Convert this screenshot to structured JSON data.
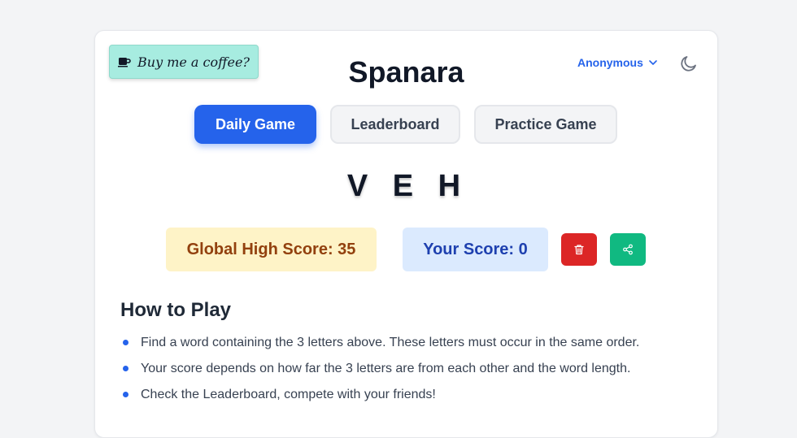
{
  "coffee": {
    "label": "Buy me a coffee?",
    "icon": "coffee-cup-icon"
  },
  "app": {
    "title": "Spanara"
  },
  "user": {
    "name": "Anonymous",
    "icon": "chevron-down-icon"
  },
  "theme_toggle": {
    "icon": "moon-icon"
  },
  "tabs": [
    {
      "label": "Daily Game",
      "active": true
    },
    {
      "label": "Leaderboard",
      "active": false
    },
    {
      "label": "Practice Game",
      "active": false
    }
  ],
  "puzzle": {
    "letters": "V E H"
  },
  "scores": {
    "global": "Global High Score: 35",
    "yours": "Your Score: 0"
  },
  "actions": {
    "delete_icon": "trash-icon",
    "share_icon": "share-icon"
  },
  "how_to_play": {
    "heading": "How to Play",
    "rules": [
      "Find a word containing the 3 letters above. These letters must occur in the same order.",
      "Your score depends on how far the 3 letters are from each other and the word length.",
      "Check the Leaderboard, compete with your friends!"
    ]
  },
  "colors": {
    "accent": "#2563eb",
    "coffee_bg": "#a7ece0",
    "global_bg": "#fef3c7",
    "yours_bg": "#dbeafe",
    "delete": "#dc2626",
    "share": "#10b981"
  }
}
